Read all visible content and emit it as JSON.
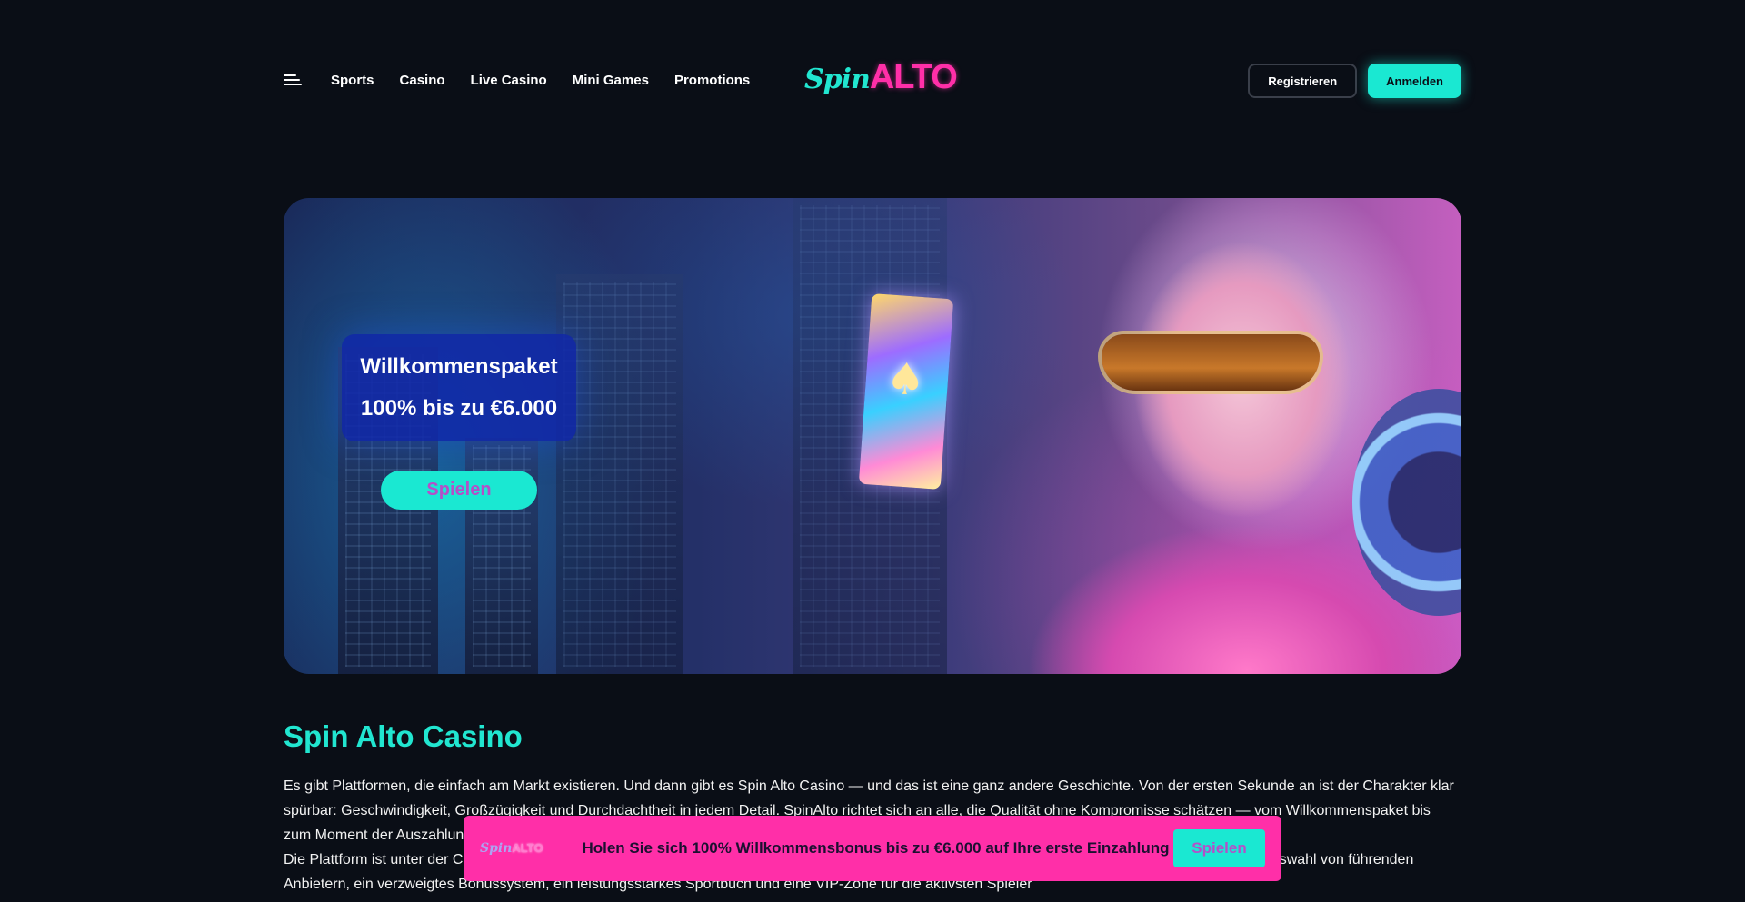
{
  "header": {
    "menu_icon": "hamburger-menu-icon",
    "nav": [
      "Sports",
      "Casino",
      "Live Casino",
      "Mini Games",
      "Promotions"
    ],
    "logo": {
      "spin": "Spin",
      "alto": "ALTO"
    },
    "register_label": "Registrieren",
    "login_label": "Anmelden"
  },
  "hero": {
    "promo_line1": "Willkommenspaket",
    "promo_line2": "100% bis zu €6.000",
    "play_label": "Spielen"
  },
  "content": {
    "title": "Spin Alto Casino",
    "paragraph1": "Es gibt Plattformen, die einfach am Markt existieren. Und dann gibt es Spin Alto Casino — und das ist eine ganz andere Geschichte. Von der ersten Sekunde an ist der Charakter klar spürbar: Geschwindigkeit, Großzügigkeit und Durchdachtheit in jedem Detail. SpinAlto richtet sich an alle, die Qualität ohne Kompromisse schätzen — vom Willkommenspaket bis zum Moment der Auszahlung.",
    "paragraph2": "Die Plattform ist unter der Curaçao-Lizenz tätig, wodurch ein hohes Maß an Sicherheit und Schutz finanzieller Transaktionen garantiert. Eine breite Spielauswahl von führenden Anbietern, ein verzweigtes Bonussystem, ein leistungsstarkes Sportbuch und eine VIP-Zone für die aktivsten Spieler"
  },
  "banner": {
    "logo": {
      "spin": "Spin",
      "alto": "ALTO"
    },
    "text": "Holen Sie sich 100% Willkommensbonus bis zu €6.000 auf Ihre erste Einzahlung",
    "button_label": "Spielen"
  },
  "colors": {
    "background": "#0a0e16",
    "accent_teal": "#1ae8d2",
    "accent_pink": "#ff2fa8",
    "promo_blue": "#1028aa"
  }
}
